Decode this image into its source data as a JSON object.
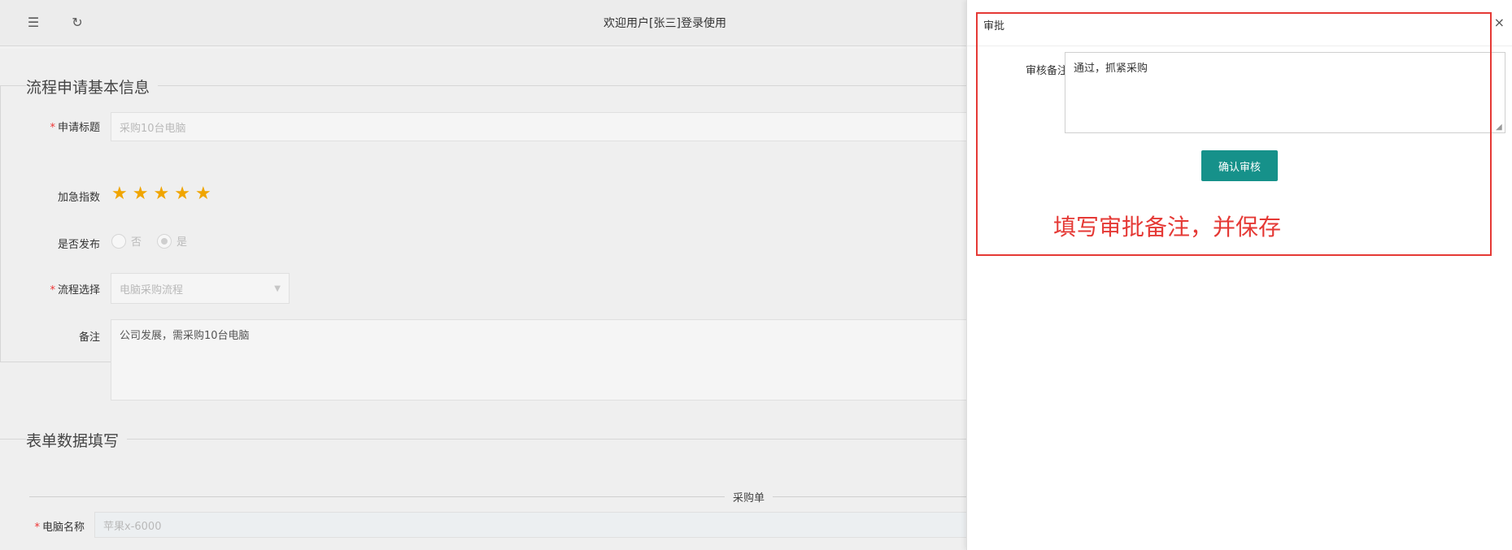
{
  "header": {
    "welcome_text": "欢迎用户[张三]登录使用",
    "menu_icon": "menu-icon",
    "refresh_icon": "refresh-icon"
  },
  "basic_info": {
    "section_title": "流程申请基本信息",
    "fields": {
      "title_label": "申请标题",
      "title_value": "采购10台电脑",
      "urgency_label": "加急指数",
      "urgency_stars": 5,
      "publish_label": "是否发布",
      "publish_options": [
        "否",
        "是"
      ],
      "publish_selected": "是",
      "process_label": "流程选择",
      "process_value": "电脑采购流程",
      "remark_label": "备注",
      "remark_value": "公司发展，需采购10台电脑"
    },
    "required_mark": "*"
  },
  "form_data": {
    "section_title": "表单数据填写",
    "divider_label": "采购单",
    "computer_name_label": "电脑名称",
    "computer_name_value": "苹果x-6000"
  },
  "drawer": {
    "title": "审批",
    "close_symbol": "×",
    "remark_label": "审核备注",
    "remark_value": "通过，抓紧采购",
    "confirm_label": "确认审核"
  },
  "annotation": {
    "text": "填写审批备注，并保存",
    "color": "#e53935"
  },
  "colors": {
    "accent": "#16918a",
    "star": "#f0a500",
    "required": "#e33"
  }
}
